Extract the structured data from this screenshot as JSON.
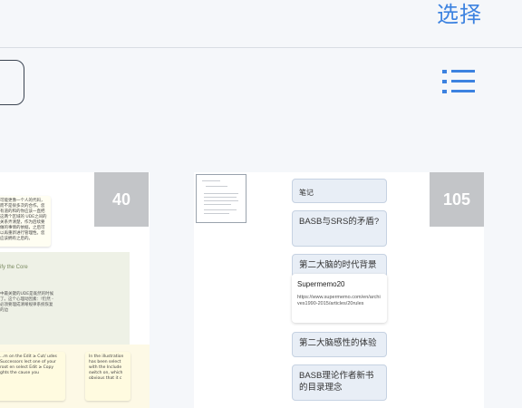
{
  "header": {
    "select_label": "选择"
  },
  "toolbar": {
    "view_icon": "list-view-icon"
  },
  "colors": {
    "accent": "#3c82e0",
    "badge_bg": "#c3c5c8",
    "card_bg": "#ffffff",
    "chip_bg": "#e8eef6"
  },
  "cards": [
    {
      "badge": "40",
      "notes": {
        "note_a": "可能更像一个人的代码，而不是很多次的合作。您有道的和的你应该一直把这两个区域的 UDE之间的关系弄清楚，作为后续要做的事情的依据，之后可以再重新进行管理性。您应该拥有之后的。",
        "core_label": "ify the Core",
        "mid_text": "中最关键的UDE是既然的时候了。这个心理动因素：!仍然 - 必须要理成清晰规律系统恢复的边",
        "note_b": "...m on the Edit ≥ Cut/ udes Successors lect one of your root en select Edit ≥ Copy ghts the cause you",
        "note_c": "In the illustration has been select with the Include switch on, which obvious that it c"
      }
    },
    {
      "badge": "105",
      "items": [
        {
          "text": "笔记"
        },
        {
          "text": "BASB与SRS的矛盾?"
        },
        {
          "text": "第二大脑的时代背景"
        },
        {
          "title": "Supermemo20",
          "url": "https://www.supermemo.com/en/archives1990-2015/articles/20rules"
        },
        {
          "text": "第二大脑感性的体验"
        },
        {
          "text": "BASB理论作者新书的目录理念"
        }
      ]
    }
  ]
}
